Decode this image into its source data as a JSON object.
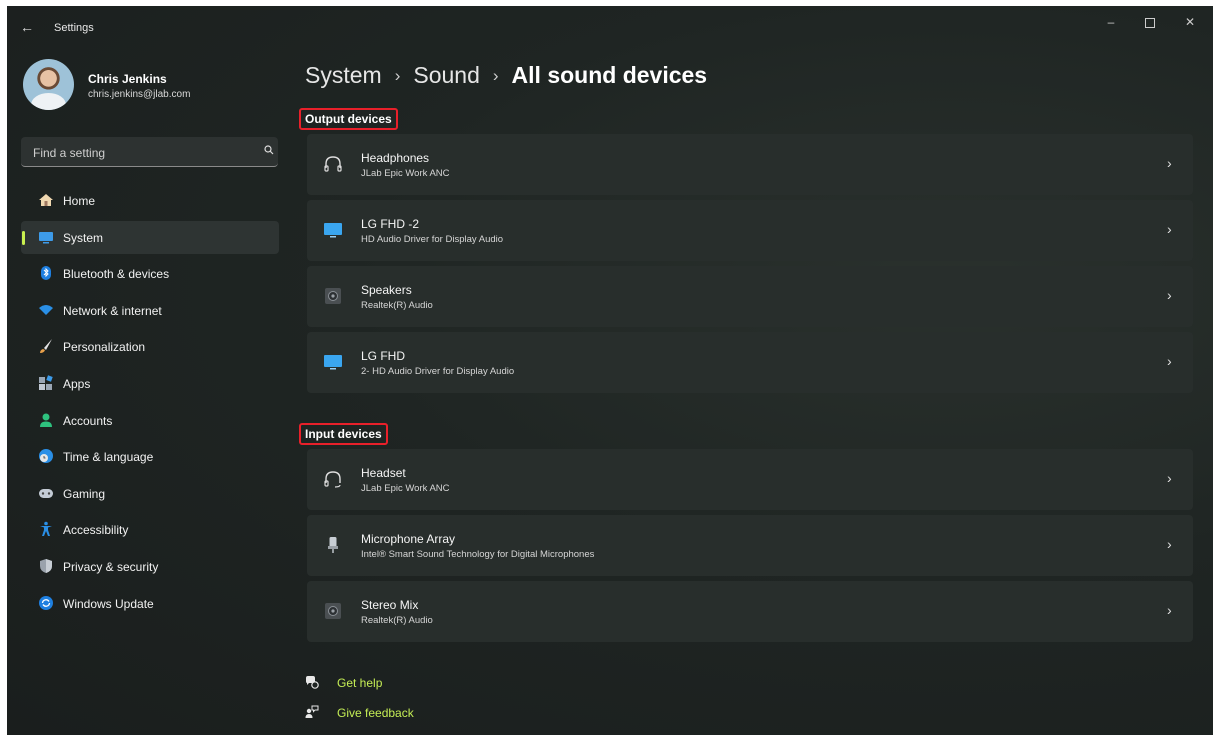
{
  "window": {
    "app_title": "Settings",
    "controls": {
      "minimize": "–",
      "maximize": "□",
      "close": "✕"
    }
  },
  "user": {
    "name": "Chris Jenkins",
    "email": "chris.jenkins@jlab.com"
  },
  "search": {
    "placeholder": "Find a setting"
  },
  "sidebar": {
    "items": [
      {
        "label": "Home",
        "icon": "home-icon",
        "active": false
      },
      {
        "label": "System",
        "icon": "system-icon",
        "active": true
      },
      {
        "label": "Bluetooth & devices",
        "icon": "bluetooth-icon",
        "active": false
      },
      {
        "label": "Network & internet",
        "icon": "wifi-icon",
        "active": false
      },
      {
        "label": "Personalization",
        "icon": "brush-icon",
        "active": false
      },
      {
        "label": "Apps",
        "icon": "apps-icon",
        "active": false
      },
      {
        "label": "Accounts",
        "icon": "person-icon",
        "active": false
      },
      {
        "label": "Time & language",
        "icon": "globe-clock-icon",
        "active": false
      },
      {
        "label": "Gaming",
        "icon": "gamepad-icon",
        "active": false
      },
      {
        "label": "Accessibility",
        "icon": "accessibility-icon",
        "active": false
      },
      {
        "label": "Privacy & security",
        "icon": "shield-icon",
        "active": false
      },
      {
        "label": "Windows Update",
        "icon": "update-icon",
        "active": false
      }
    ]
  },
  "breadcrumb": {
    "level1": "System",
    "level2": "Sound",
    "current": "All sound devices",
    "separator": "›"
  },
  "output_section": {
    "label": "Output devices",
    "devices": [
      {
        "name": "Headphones",
        "description": "JLab Epic Work ANC",
        "icon": "headphones-icon"
      },
      {
        "name": "LG FHD -2",
        "description": "HD Audio Driver for Display Audio",
        "icon": "monitor-icon"
      },
      {
        "name": "Speakers",
        "description": "Realtek(R) Audio",
        "icon": "speaker-icon"
      },
      {
        "name": "LG FHD",
        "description": "2- HD Audio Driver for Display Audio",
        "icon": "monitor-icon"
      }
    ]
  },
  "input_section": {
    "label": "Input devices",
    "devices": [
      {
        "name": "Headset",
        "description": "JLab Epic Work ANC",
        "icon": "headset-icon"
      },
      {
        "name": "Microphone Array",
        "description": "Intel® Smart Sound Technology for Digital Microphones",
        "icon": "microphone-icon"
      },
      {
        "name": "Stereo Mix",
        "description": "Realtek(R) Audio",
        "icon": "speaker-icon"
      }
    ]
  },
  "links": {
    "get_help": "Get help",
    "give_feedback": "Give feedback"
  },
  "colors": {
    "accent": "#c5ee55",
    "highlight_border": "#e8202a",
    "card_bg": "#282e2c"
  }
}
